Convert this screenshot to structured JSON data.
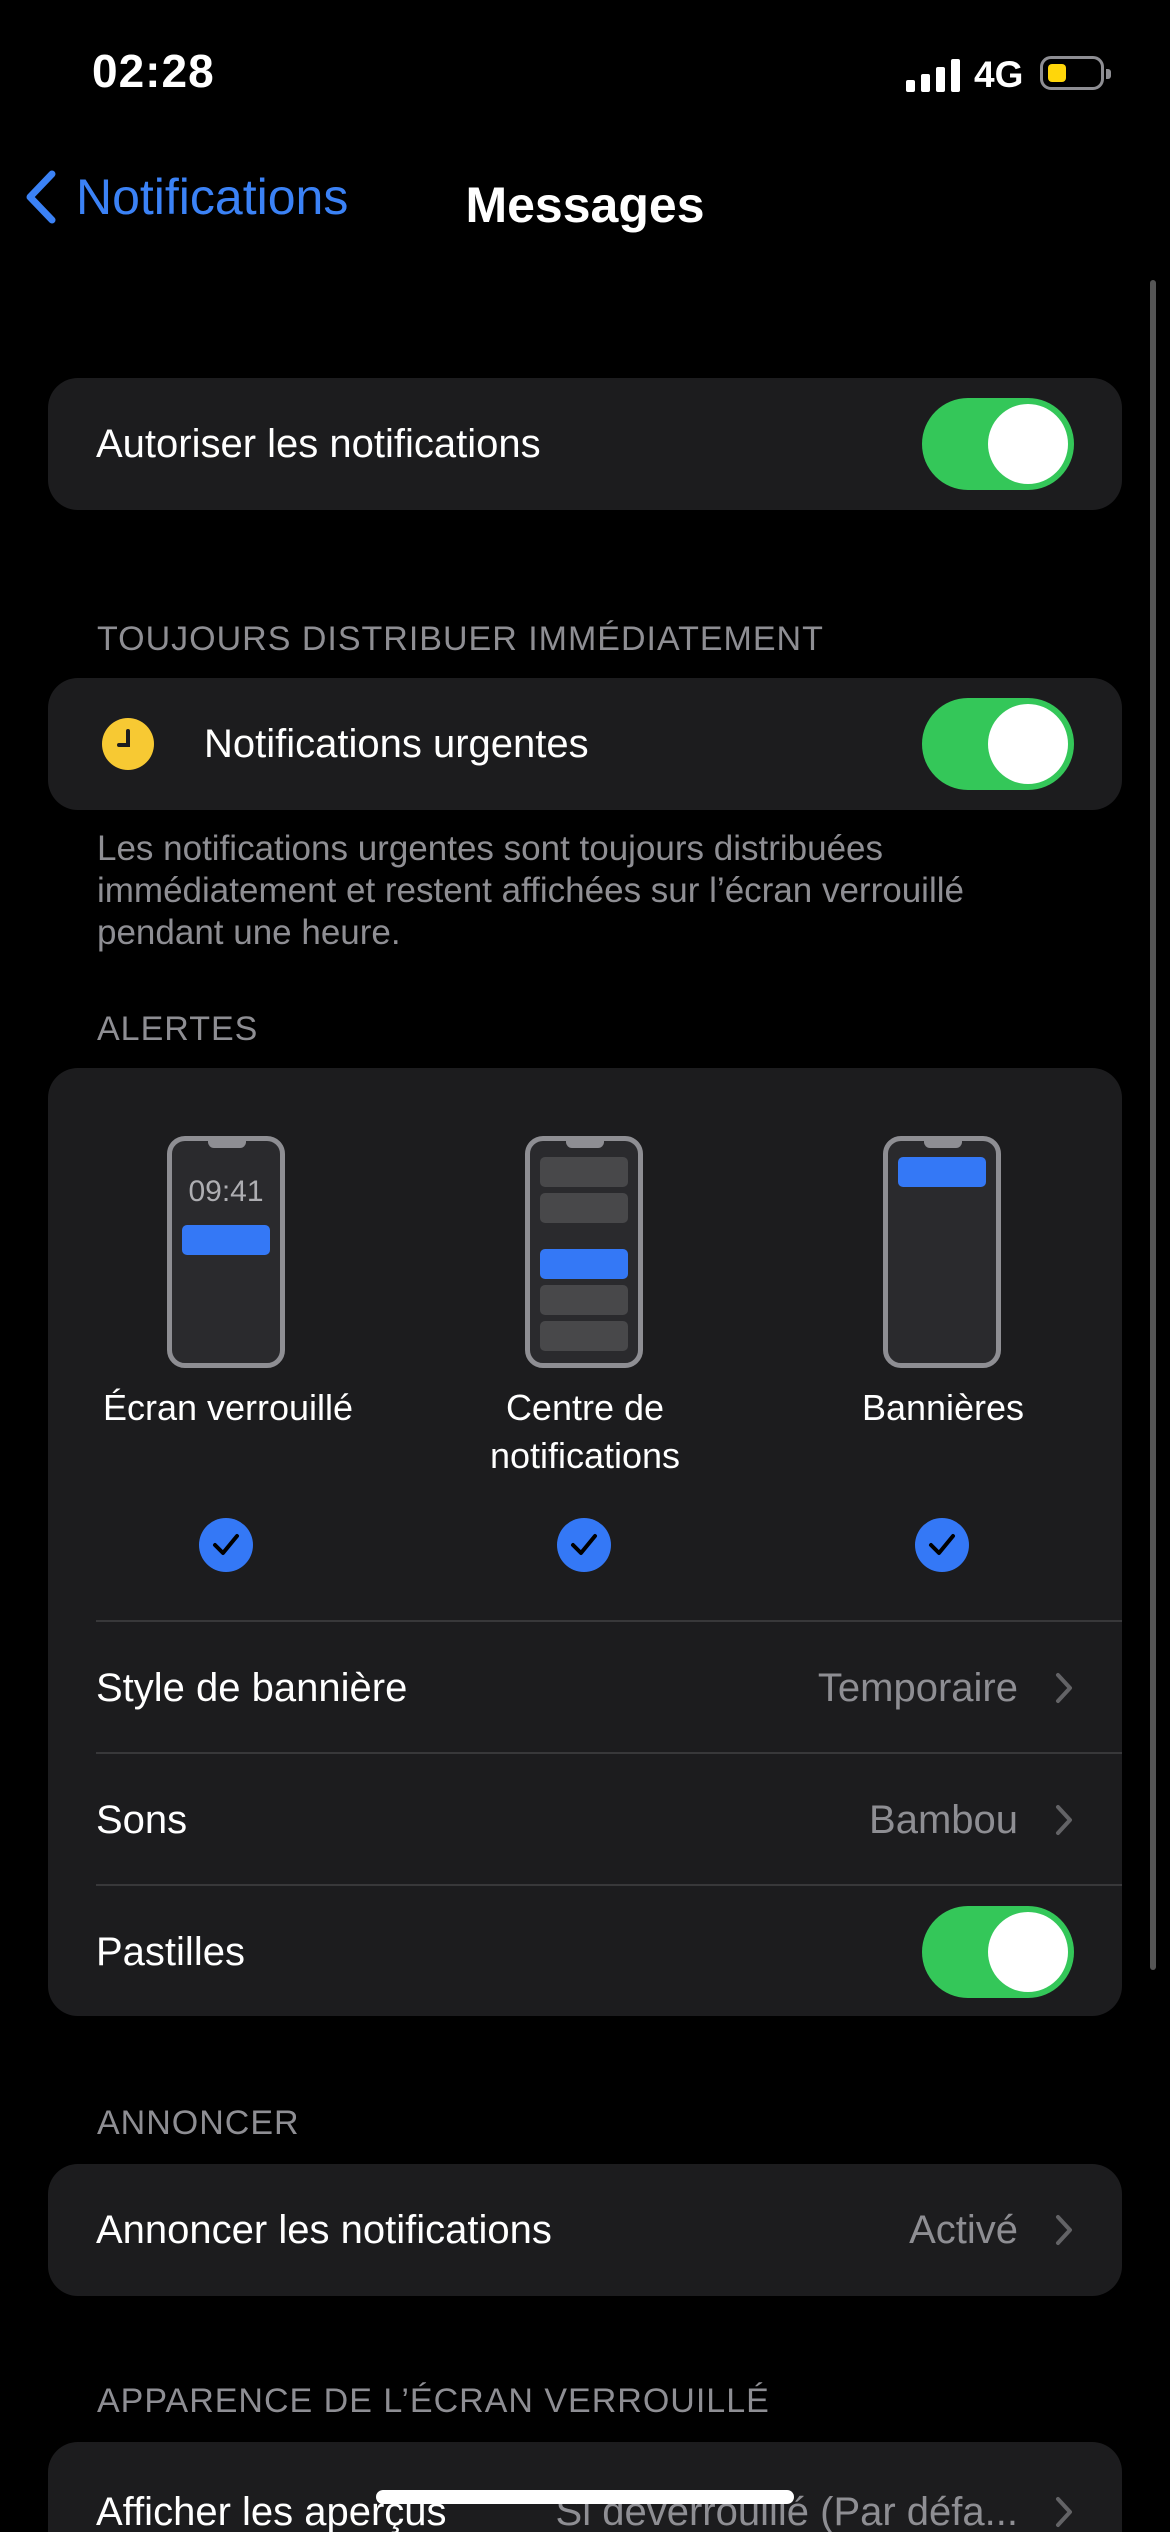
{
  "status_bar": {
    "time": "02:28",
    "network": "4G",
    "battery_color": "#ffd60a"
  },
  "nav": {
    "back_label": "Notifications",
    "title": "Messages"
  },
  "allow": {
    "label": "Autoriser les notifications",
    "enabled": true
  },
  "urgent": {
    "header": "TOUJOURS DISTRIBUER IMMÉDIATEMENT",
    "label": "Notifications urgentes",
    "enabled": true,
    "footer": "Les notifications urgentes sont toujours distribuées immédiatement et restent affichées sur l’écran verrouillé pendant une heure."
  },
  "alerts": {
    "header": "ALERTES",
    "options": [
      {
        "label": "Écran verrouillé",
        "checked": true,
        "phone_time": "09:41"
      },
      {
        "label": "Centre de notifications",
        "checked": true
      },
      {
        "label": "Bannières",
        "checked": true
      }
    ],
    "banner_style": {
      "label": "Style de bannière",
      "value": "Temporaire"
    },
    "sounds": {
      "label": "Sons",
      "value": "Bambou"
    },
    "badges": {
      "label": "Pastilles",
      "enabled": true
    }
  },
  "announce": {
    "header": "ANNONCER",
    "label": "Annoncer les notifications",
    "value": "Activé"
  },
  "lockscreen": {
    "header": "APPARENCE DE L’ÉCRAN VERROUILLÉ",
    "label": "Afficher les aperçus",
    "value": "Si déverrouillé (Par défa..."
  },
  "colors": {
    "accent": "#3478f6",
    "toggle_on": "#34c759",
    "background": "#000000",
    "cell": "#1c1c1e"
  }
}
